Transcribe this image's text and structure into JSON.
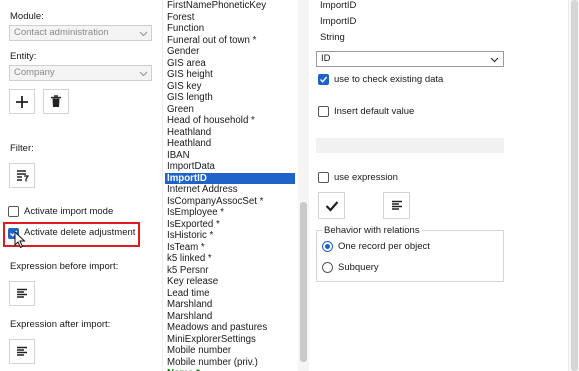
{
  "left_panel": {
    "module_label": "Module:",
    "module_value": "Contact administration",
    "entity_label": "Entity:",
    "entity_value": "Company",
    "filter_label": "Filter:",
    "activate_import_mode": {
      "label": "Activate import mode",
      "checked": false
    },
    "activate_delete_adjustment": {
      "label": "Activate delete adjustment",
      "checked": true
    },
    "expression_before_label": "Expression before import:",
    "expression_after_label": "Expression after import:"
  },
  "field_list": {
    "items": [
      "FirstNamePhoneticKey",
      "Forest",
      "Function",
      "Funeral out of town *",
      "Gender",
      "GIS area",
      "GIS height",
      "GIS key",
      "GIS length",
      "Green",
      "Head of household *",
      "Heathland",
      "Heathland",
      "IBAN",
      "ImportData",
      "ImportID",
      "Internet Address",
      "IsCompanyAssocSet *",
      "IsEmployee *",
      "IsExported *",
      "IsHistoric *",
      "IsTeam *",
      "k5 linked *",
      "k5 Persnr",
      "Key release",
      "Lead time",
      "Marshland",
      "Marshland",
      "Meadows and pastures",
      "MiniExplorerSettings",
      "Mobile number",
      "Mobile number (priv.)",
      "Name *"
    ],
    "selected_index": 15,
    "bold_index": 32
  },
  "right_panel": {
    "line1": "ImportID",
    "line2": "ImportID",
    "line3": "String",
    "combo_value": "ID",
    "use_to_check": {
      "label": "use to check existing data",
      "checked": true
    },
    "insert_default": {
      "label": "Insert default value",
      "checked": false
    },
    "use_expression": {
      "label": "use expression",
      "checked": false
    },
    "behavior_title": "Behavior with relations",
    "radio_one": {
      "label": "One record per object",
      "selected": true
    },
    "radio_sub": {
      "label": "Subquery",
      "selected": false
    }
  },
  "colors": {
    "accent": "#1d63c9",
    "highlight_border": "#e01b1b",
    "bold_item": "#0f7b0f"
  }
}
